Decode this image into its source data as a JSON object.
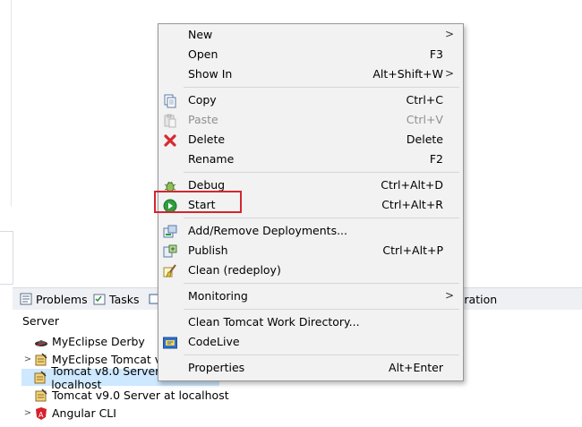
{
  "views_tabbar": {
    "tabs": [
      {
        "label": "Problems",
        "icon": "problems-icon"
      },
      {
        "label": "Tasks",
        "icon": "tasks-icon"
      },
      {
        "label": "igration",
        "icon": ""
      }
    ]
  },
  "server_view": {
    "header": "Server",
    "items": [
      {
        "label": "MyEclipse Derby",
        "icon": "derby-icon",
        "expandable": false
      },
      {
        "label": "MyEclipse Tomcat v",
        "icon": "tomcat-icon",
        "expandable": true
      },
      {
        "label": "Tomcat v8.0 Server at localhost",
        "icon": "tomcat-icon",
        "expandable": false,
        "selected": true
      },
      {
        "label": "Tomcat v9.0 Server at localhost",
        "icon": "tomcat-icon",
        "expandable": false
      },
      {
        "label": "Angular CLI",
        "icon": "angular-icon",
        "expandable": true
      }
    ]
  },
  "context_menu": {
    "items": {
      "new": {
        "label": "New",
        "shortcut": "",
        "submenu": ">"
      },
      "open": {
        "label": "Open",
        "shortcut": "F3"
      },
      "show_in": {
        "label": "Show In",
        "shortcut": "Alt+Shift+W",
        "submenu": ">"
      },
      "copy": {
        "label": "Copy",
        "shortcut": "Ctrl+C",
        "icon": "copy-icon"
      },
      "paste": {
        "label": "Paste",
        "shortcut": "Ctrl+V",
        "icon": "paste-icon",
        "disabled": true
      },
      "delete": {
        "label": "Delete",
        "shortcut": "Delete",
        "icon": "delete-icon"
      },
      "rename": {
        "label": "Rename",
        "shortcut": "F2"
      },
      "debug": {
        "label": "Debug",
        "shortcut": "Ctrl+Alt+D",
        "icon": "debug-icon"
      },
      "start": {
        "label": "Start",
        "shortcut": "Ctrl+Alt+R",
        "icon": "start-icon"
      },
      "add_remove": {
        "label": "Add/Remove Deployments...",
        "icon": "deployments-icon"
      },
      "publish": {
        "label": "Publish",
        "shortcut": "Ctrl+Alt+P",
        "icon": "publish-icon"
      },
      "clean": {
        "label": "Clean (redeploy)",
        "icon": "clean-icon"
      },
      "monitoring": {
        "label": "Monitoring",
        "submenu": ">"
      },
      "clean_work": {
        "label": "Clean Tomcat Work Directory..."
      },
      "codelive": {
        "label": "CodeLive",
        "icon": "codelive-icon"
      },
      "properties": {
        "label": "Properties",
        "shortcut": "Alt+Enter"
      }
    }
  },
  "colors": {
    "menu_bg": "#f2f2f2",
    "highlight_border": "#d3262e",
    "selection_bg": "#cde8ff",
    "start_green": "#2e9e3e",
    "delete_red": "#d9282f"
  }
}
